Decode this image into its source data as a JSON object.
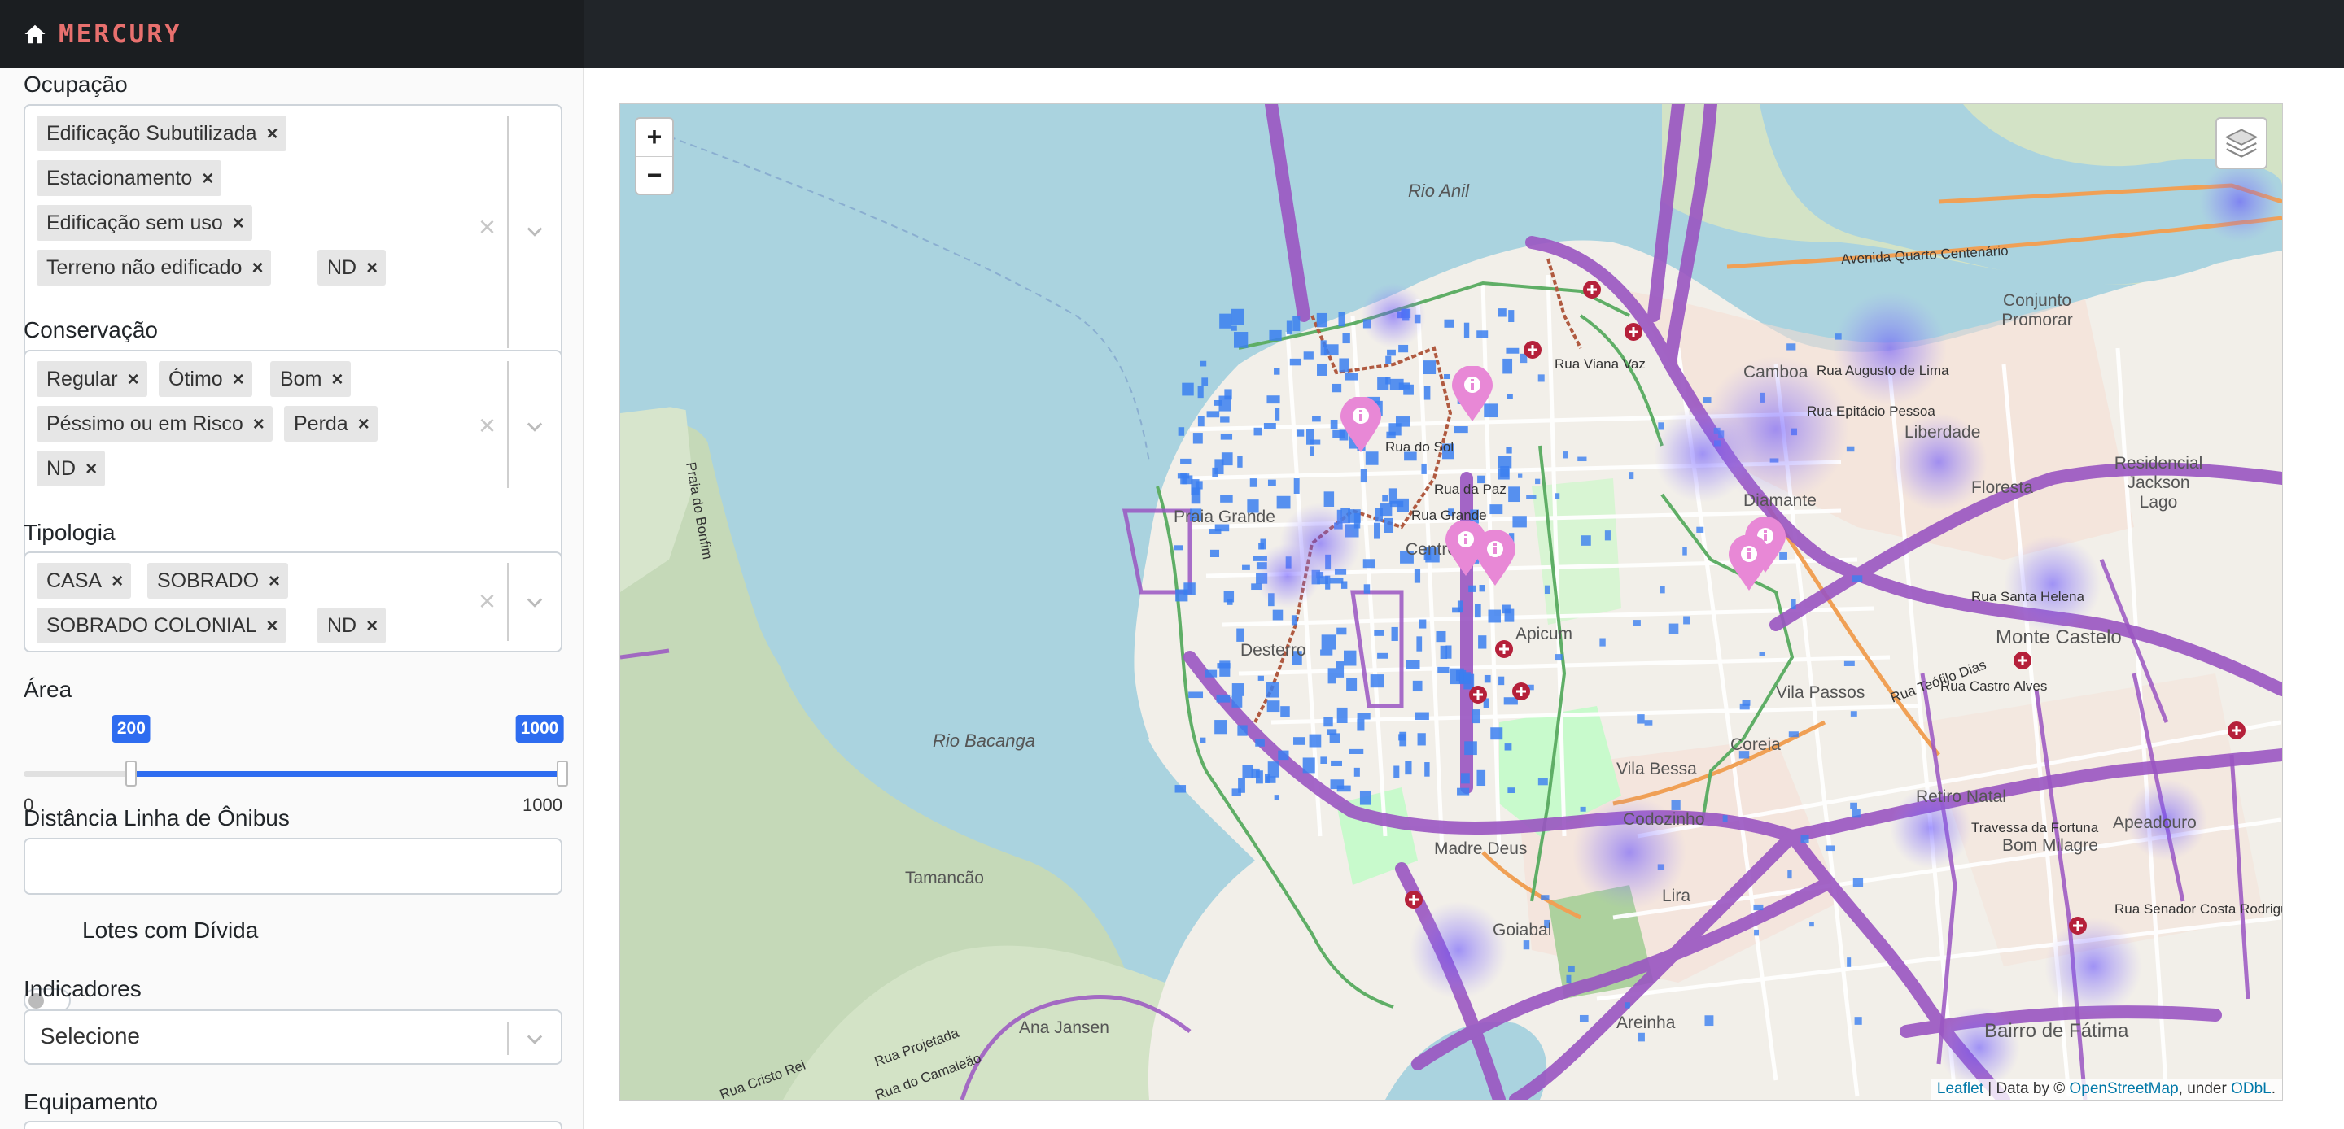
{
  "brand": {
    "name": "MERCURY",
    "icon": "home-icon"
  },
  "filters": {
    "ocupacao": {
      "label": "Ocupação",
      "tags": [
        "Edificação Subutilizada",
        "Estacionamento",
        "Edificação sem uso",
        "Terreno não edificado",
        "ND"
      ]
    },
    "conservacao": {
      "label": "Conservação",
      "tags": [
        "Regular",
        "Ótimo",
        "Bom",
        "Péssimo ou em Risco",
        "Perda",
        "ND"
      ]
    },
    "tipologia": {
      "label": "Tipologia",
      "tags": [
        "CASA",
        "SOBRADO",
        "SOBRADO COLONIAL",
        "ND"
      ]
    },
    "area": {
      "label": "Área",
      "min": 0,
      "max": 1000,
      "low": 200,
      "high": 1000,
      "min_label": "0",
      "max_label": "1000",
      "low_label": "200",
      "high_label": "1000"
    },
    "distancia": {
      "label": "Distância Linha de Ônibus",
      "value": ""
    },
    "divida": {
      "label": "Lotes com Dívida",
      "checked": false
    },
    "indicadores": {
      "label": "Indicadores",
      "value": "Selecione"
    },
    "equipamento": {
      "label": "Equipamento"
    }
  },
  "map": {
    "zoom_in": "+",
    "zoom_out": "−",
    "water_labels": [
      "Rio Anil",
      "Rio Bacanga"
    ],
    "neighborhoods": [
      "Camboa",
      "Liberdade",
      "Conjunto Promorar",
      "Floresta",
      "Residencial Jackson Lago",
      "Diamante",
      "Monte Castelo",
      "Vila Passos",
      "Coreia",
      "Retiro Natal",
      "Apeadouro",
      "Bom Milagre",
      "Vila Bessa",
      "Codozinho",
      "Madre Deus",
      "Lira",
      "Goiabal",
      "Areinha",
      "Bairro de Fátima",
      "Tamancão",
      "Ana Jansen",
      "Apicum",
      "Desterro",
      "Centro",
      "Praia Grande"
    ],
    "streets": [
      "Avenida Quarto Centenário",
      "Rua Augusto de Lima",
      "Rua Epitácio Pessoa",
      "Rua Santa Helena",
      "Rua Teófilo Dias",
      "Rua Castro Alves",
      "Travessa da Fortuna",
      "Rua Senador Costa Rodrigues",
      "Rua do Sol",
      "Rua da Paz",
      "Rua Grande",
      "Rua Viana Vaz",
      "Praia do Bonfim",
      "Rua Cristo Rei",
      "Rua do Camaleão",
      "Rua Projetada"
    ],
    "attribution": {
      "leaflet": "Leaflet",
      "data_by": " | Data by © ",
      "osm": "OpenStreetMap",
      "under": ", under ",
      "odbl": "ODbL",
      "dot": "."
    },
    "accent_colors": {
      "roads": "#8e4fb5",
      "markers": "#e888d6",
      "lots": "#3b7ff0",
      "heat": "#6a55ff"
    }
  }
}
